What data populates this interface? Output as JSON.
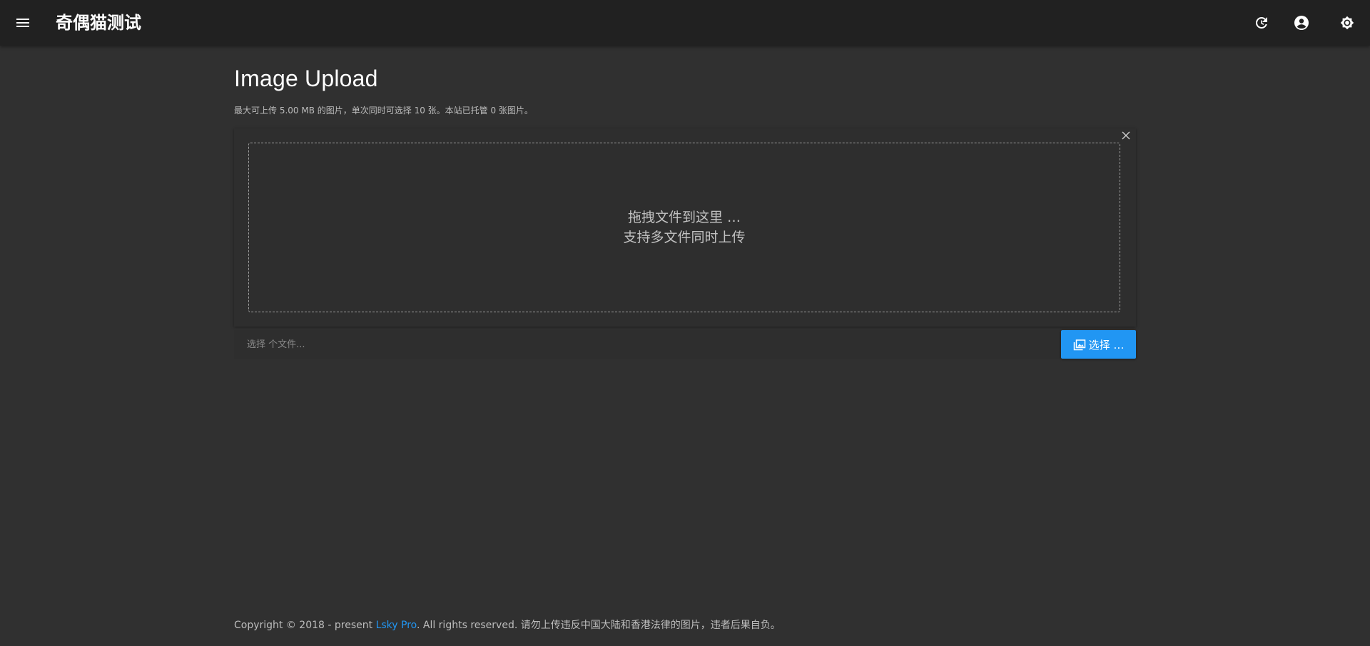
{
  "appbar": {
    "title": "奇偶猫测试",
    "icons": {
      "menu": "menu-icon",
      "refresh": "refresh-icon",
      "account": "account-circle-icon",
      "theme": "brightness-icon"
    }
  },
  "main": {
    "title": "Image Upload",
    "subtitle": "最大可上传 5.00 MB 的图片，单次同时可选择 10 张。本站已托管 0 张图片。",
    "drop_zone": {
      "line1": "拖拽文件到这里 …",
      "line2": "支持多文件同时上传"
    },
    "file_input": {
      "placeholder": "选择 个文件..."
    },
    "select_button_label": "选择 …"
  },
  "footer": {
    "prefix": "Copyright © 2018 - present ",
    "link_text": "Lsky Pro",
    "suffix": ". All rights reserved. 请勿上传违反中国大陆和香港法律的图片，违者后果自负。"
  },
  "colors": {
    "background": "#303030",
    "appbar": "#212121",
    "accent": "#2196f3"
  }
}
